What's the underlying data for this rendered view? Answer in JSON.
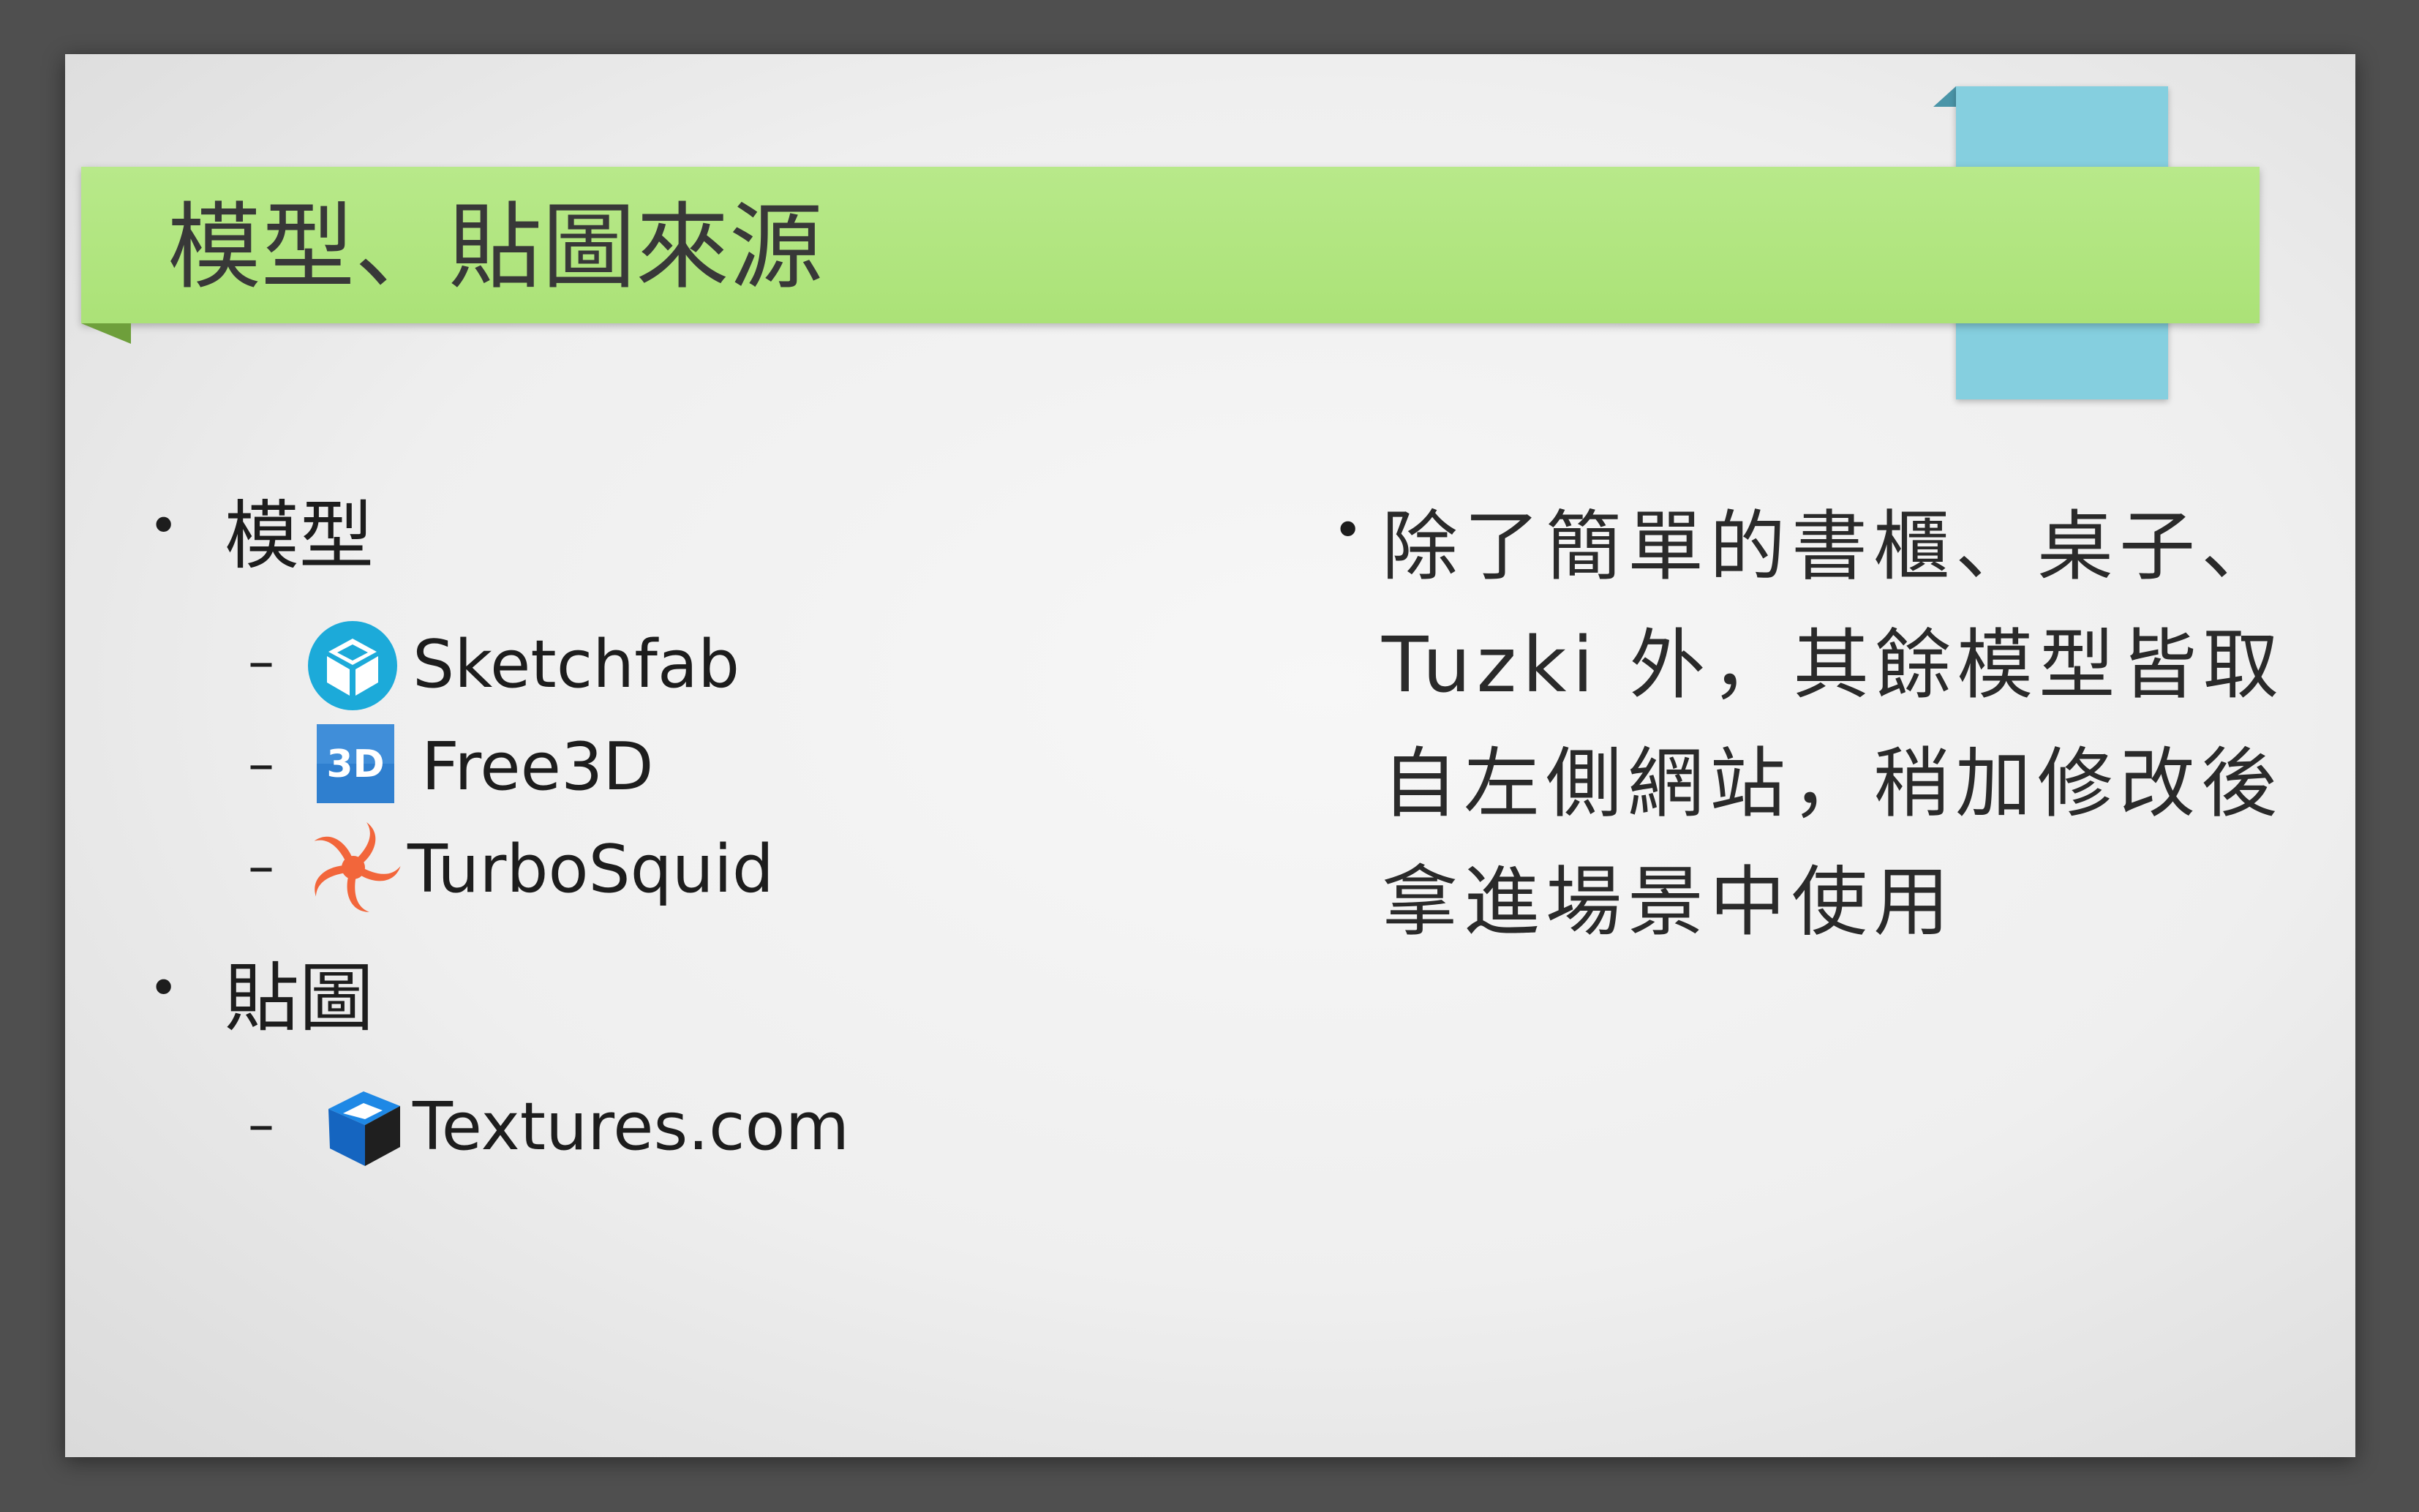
{
  "slide": {
    "title": "模型、貼圖來源",
    "left_list": [
      {
        "label": "模型",
        "items": [
          {
            "label": "Sketchfab",
            "icon": "sketchfab-logo-icon"
          },
          {
            "label": "Free3D",
            "icon": "free3d-logo-icon"
          },
          {
            "label": "TurboSquid",
            "icon": "turbosquid-logo-icon"
          }
        ]
      },
      {
        "label": "貼圖",
        "items": [
          {
            "label": "Textures.com",
            "icon": "textures-com-logo-icon"
          }
        ]
      }
    ],
    "right_text": "除了簡單的書櫃、桌子、Tuzki 外，其餘模型皆取自左側網站，稍加修改後拿進場景中使用",
    "bullet_glyph": "•",
    "dash_glyph": "–",
    "colors": {
      "title_bar": "#b2e67f",
      "blue_tab": "#85cfdf",
      "background": "#4f4f4f",
      "sketchfab_blue": "#1caad9",
      "turbosquid_orange": "#f2663b"
    }
  }
}
